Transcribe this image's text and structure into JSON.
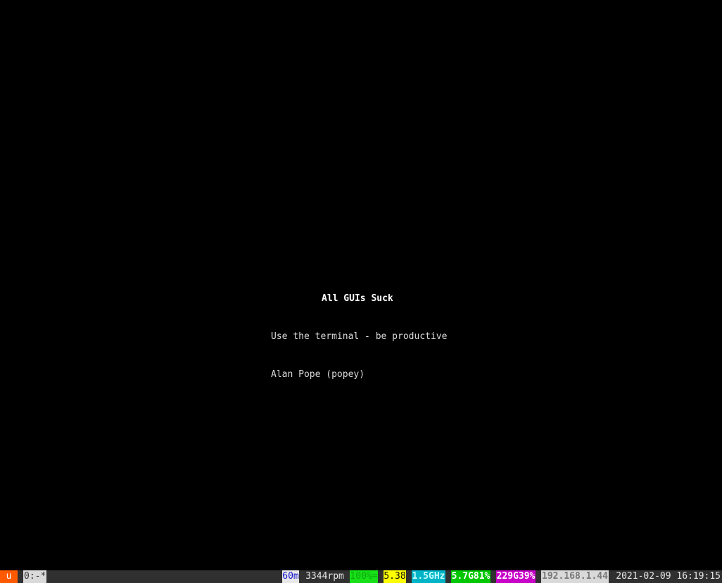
{
  "motd": {
    "title": "All GUIs Suck",
    "line1": "Use the terminal - be productive",
    "line2": "Alan Pope (popey)"
  },
  "statusbar": {
    "logo": "u",
    "window": "0:-*",
    "updates": "60m",
    "fan": "3344rpm",
    "battery": "100%=",
    "load": "5.38",
    "cpu": "1.5GHz",
    "memory": "5.7G81%",
    "disk": "229G39%",
    "ip": "192.168.1.44",
    "datetime": "2021-02-09 16:19:15"
  },
  "colors": {
    "background": "#000000",
    "statusbar": "#303030",
    "logo": "#ff5a00",
    "battery": "#18e018",
    "load": "#ffff00",
    "cpu": "#00b4c8",
    "memory": "#00c800",
    "disk": "#c800c8"
  }
}
